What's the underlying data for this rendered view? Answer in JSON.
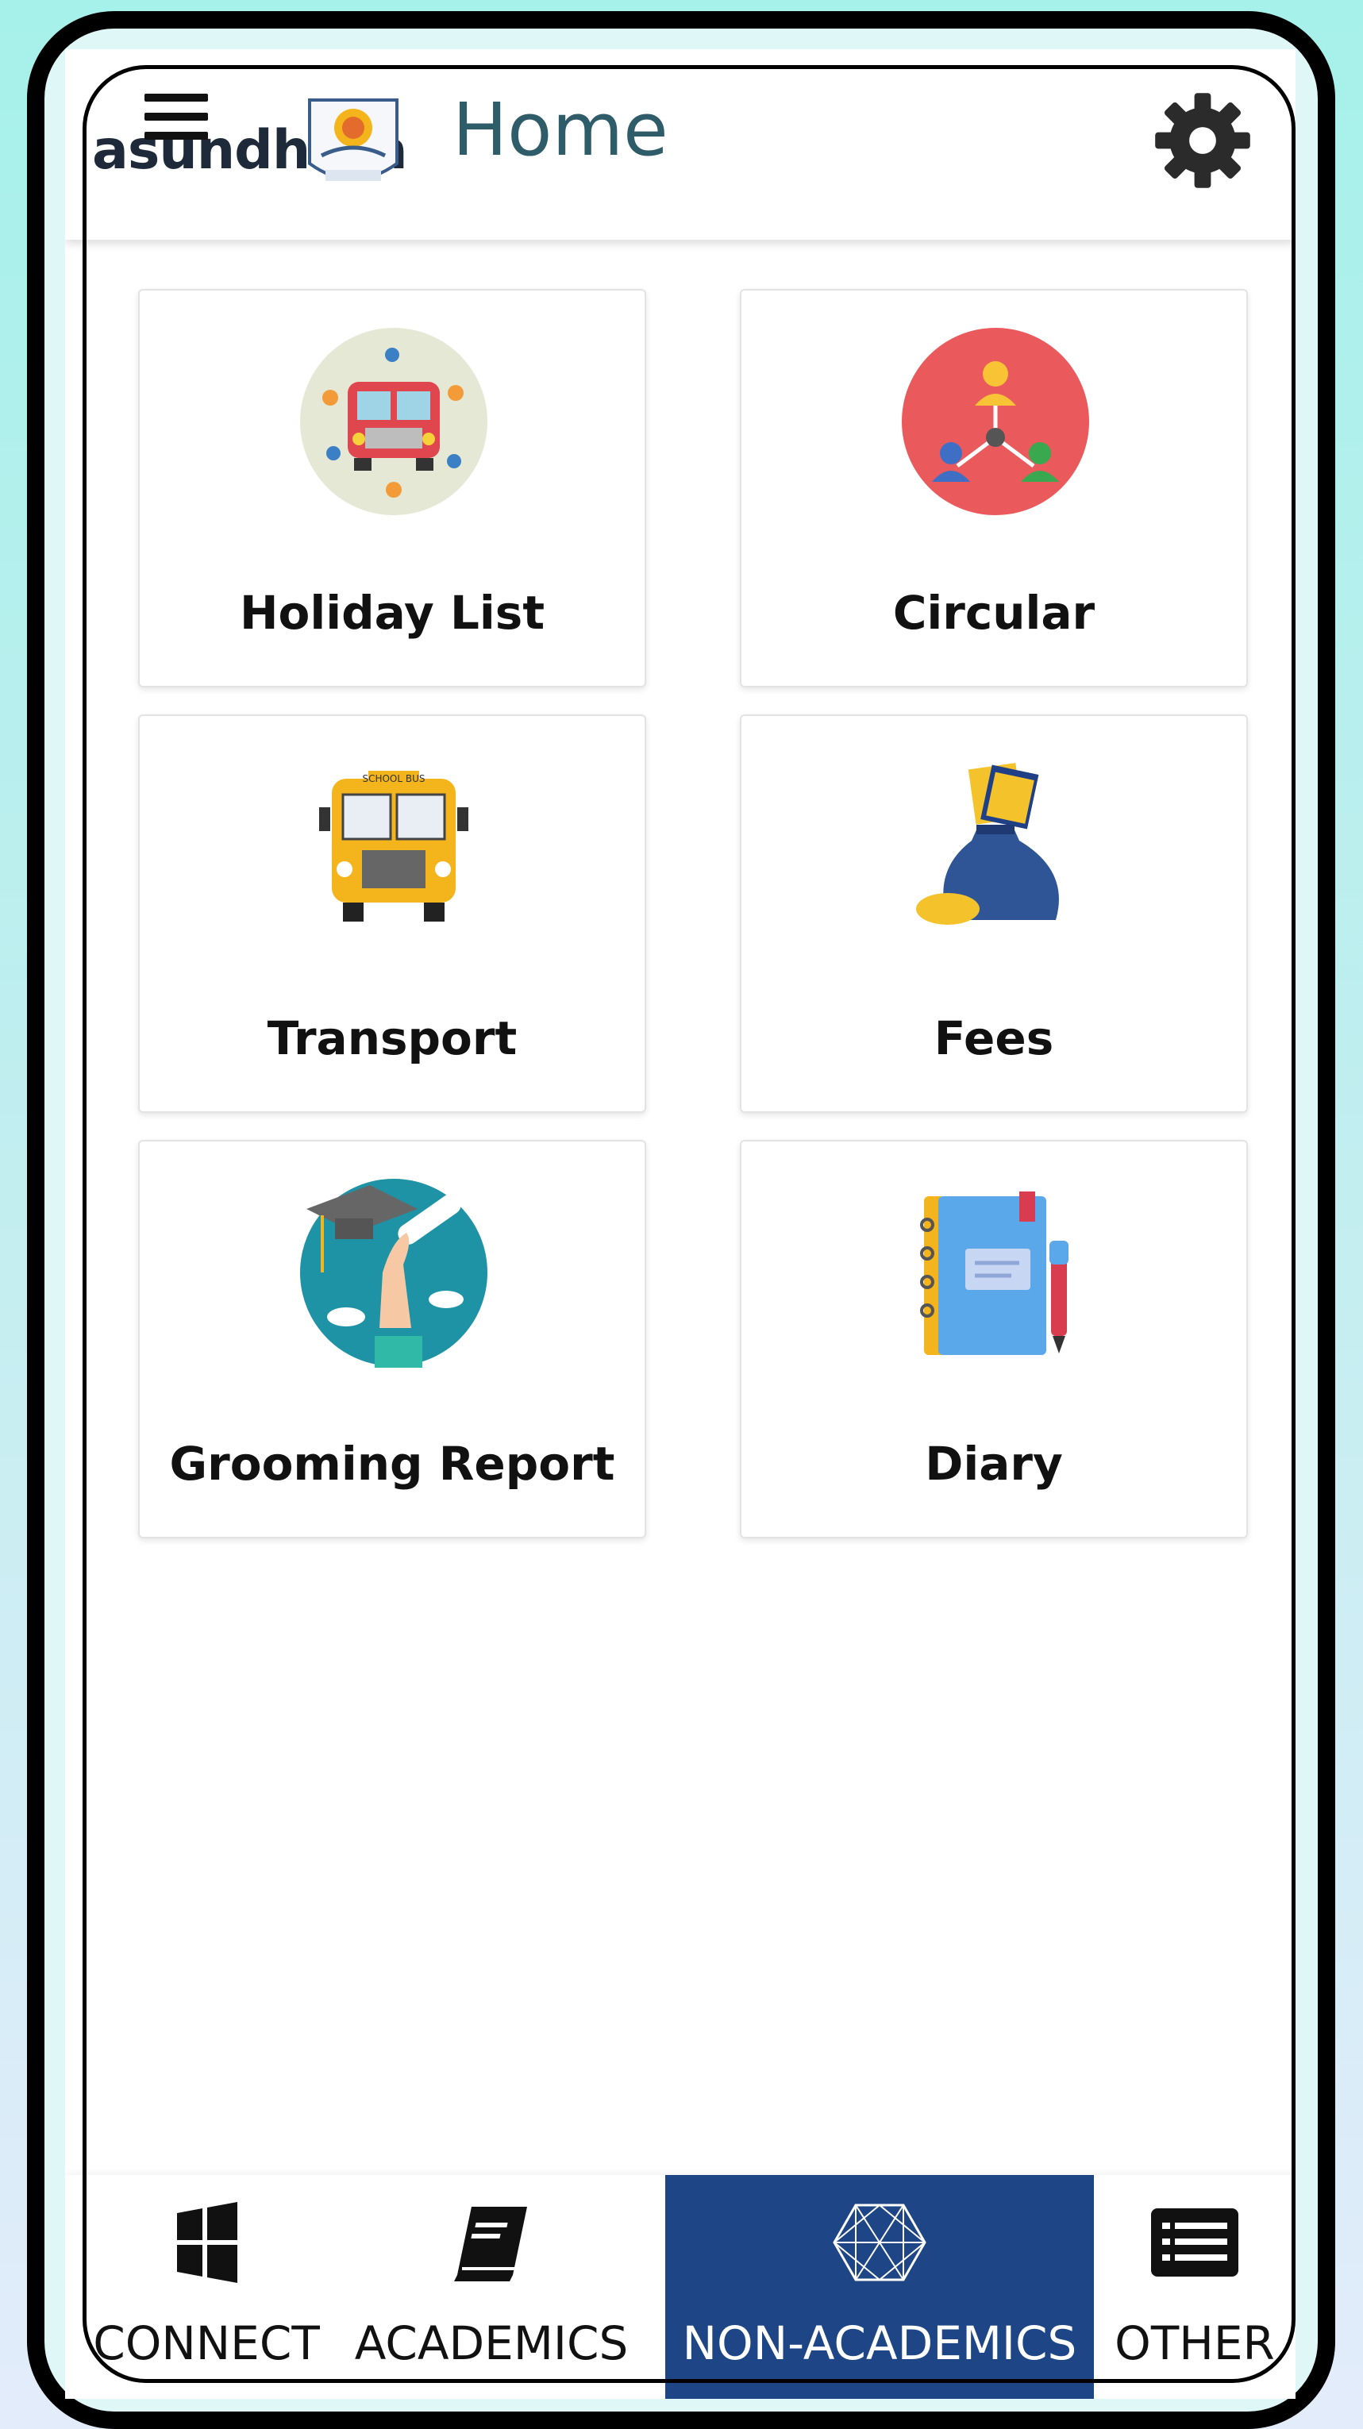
{
  "header": {
    "brand_text": "asundhara",
    "title": "Home",
    "menu_icon": "hamburger-menu-icon",
    "settings_icon": "gear-icon"
  },
  "tiles": [
    {
      "label": "Holiday List",
      "icon": "holiday-bus-icon"
    },
    {
      "label": "Circular",
      "icon": "circular-network-icon"
    },
    {
      "label": "Transport",
      "icon": "school-bus-icon"
    },
    {
      "label": "Fees",
      "icon": "money-bag-icon"
    },
    {
      "label": "Grooming Report",
      "icon": "graduation-cap-icon"
    },
    {
      "label": "Diary",
      "icon": "notebook-pen-icon"
    }
  ],
  "bottom_nav": [
    {
      "label": "CONNECT",
      "icon": "windows-icon",
      "active": false
    },
    {
      "label": "ACADEMICS",
      "icon": "book-icon",
      "active": false
    },
    {
      "label": "NON-ACADEMICS",
      "icon": "network-icon",
      "active": true
    },
    {
      "label": "OTHER",
      "icon": "list-icon",
      "active": false
    }
  ],
  "colors": {
    "nav_active_bg": "#1e4585",
    "title_color": "#2f5c69",
    "background_top": "#a6f1ea",
    "background_bottom": "#e3ecfb"
  }
}
